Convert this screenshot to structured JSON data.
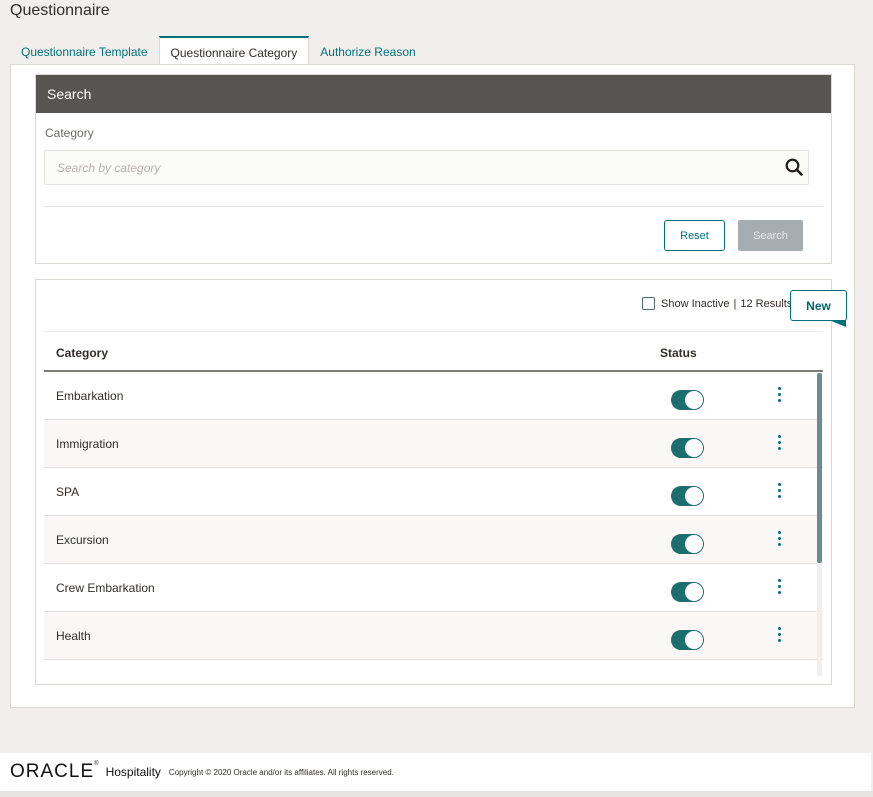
{
  "page": {
    "title": "Questionnaire"
  },
  "tabs": [
    {
      "label": "Questionnaire Template",
      "active": false
    },
    {
      "label": "Questionnaire Category",
      "active": true
    },
    {
      "label": "Authorize Reason",
      "active": false
    }
  ],
  "search": {
    "header": "Search",
    "category_label": "Category",
    "placeholder": "Search by category",
    "value": "",
    "reset_label": "Reset",
    "search_label": "Search"
  },
  "results": {
    "show_inactive_label": "Show Inactive",
    "show_inactive_checked": false,
    "separator": "|",
    "count_text": "12 Results",
    "new_label": "New",
    "columns": {
      "category": "Category",
      "status": "Status"
    },
    "rows": [
      {
        "category": "Embarkation",
        "active": true
      },
      {
        "category": "Immigration",
        "active": true
      },
      {
        "category": "SPA",
        "active": true
      },
      {
        "category": "Excursion",
        "active": true
      },
      {
        "category": "Crew Embarkation",
        "active": true
      },
      {
        "category": "Health",
        "active": true
      }
    ]
  },
  "footer": {
    "logo_text": "ORACLE",
    "product": "Hospitality",
    "copyright": "Copyright © 2020 Oracle and/or its affiliates. All rights reserved."
  },
  "colors": {
    "accent": "#007179",
    "header_bar": "#575551",
    "toggle_on": "#1c6e6e",
    "background": "#f1efed"
  },
  "icons": {
    "search": "search-icon",
    "more": "kebab-menu-icon"
  }
}
